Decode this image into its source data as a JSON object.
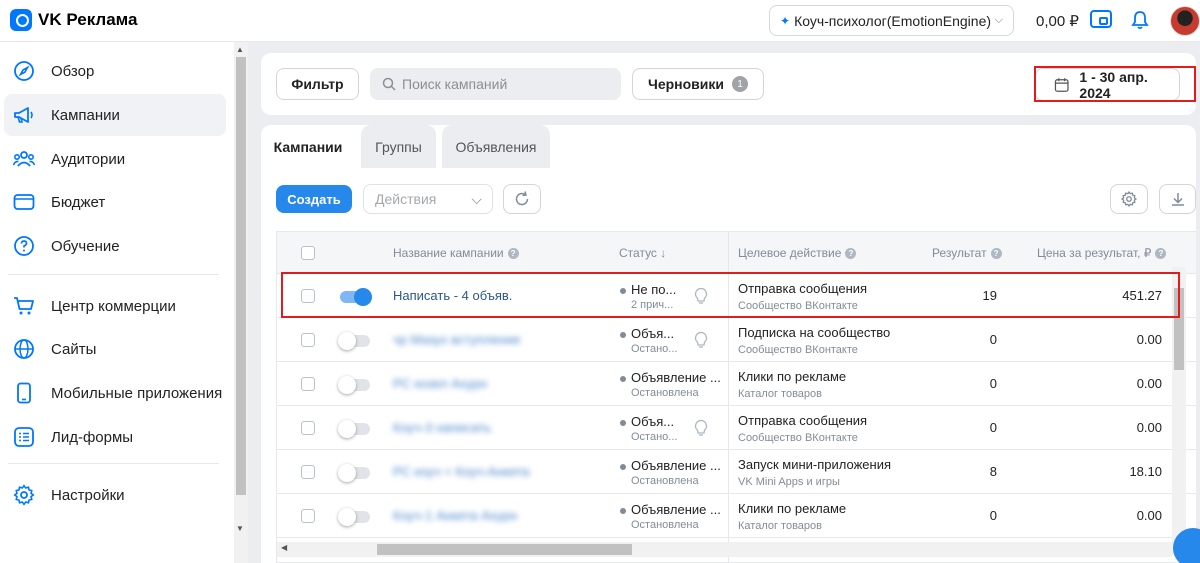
{
  "app": {
    "title": "VK Реклама"
  },
  "header": {
    "account": "Коуч-психолог(EmotionEngine)",
    "balance": "0,00 ₽"
  },
  "sidebar": {
    "items": [
      {
        "label": "Обзор",
        "icon": "compass-icon",
        "active": false
      },
      {
        "label": "Кампании",
        "icon": "megaphone-icon",
        "active": true
      },
      {
        "label": "Аудитории",
        "icon": "users-icon",
        "active": false
      },
      {
        "label": "Бюджет",
        "icon": "wallet-icon",
        "active": false
      },
      {
        "label": "Обучение",
        "icon": "question-icon",
        "active": false
      },
      {
        "label": "Центр коммерции",
        "icon": "cart-icon",
        "active": false
      },
      {
        "label": "Сайты",
        "icon": "globe-icon",
        "active": false
      },
      {
        "label": "Мобильные приложения",
        "icon": "phone-icon",
        "active": false
      },
      {
        "label": "Лид-формы",
        "icon": "list-icon",
        "active": false
      },
      {
        "label": "Настройки",
        "icon": "gear-icon",
        "active": false
      }
    ]
  },
  "filters": {
    "filter_label": "Фильтр",
    "search_placeholder": "Поиск кампаний",
    "drafts_label": "Черновики",
    "drafts_count": "1",
    "date_range": "1 - 30 апр. 2024"
  },
  "tabs": [
    {
      "label": "Кампании",
      "active": true
    },
    {
      "label": "Группы",
      "active": false
    },
    {
      "label": "Объявления",
      "active": false
    }
  ],
  "toolbar": {
    "create_label": "Создать",
    "actions_placeholder": "Действия"
  },
  "table": {
    "columns": {
      "name": "Название кампании",
      "status": "Статус",
      "status_sort": "↓",
      "target": "Целевое действие",
      "result": "Результат",
      "price": "Цена за результат, ₽"
    },
    "rows": [
      {
        "enabled": true,
        "name": "Написать - 4 объяв.",
        "name_blurred": false,
        "status": "Не по...",
        "status_sub": "2 прич...",
        "has_tip": true,
        "target": "Отправка сообщения",
        "target_sub": "Сообщество ВКонтакте",
        "result": "19",
        "price": "451.27"
      },
      {
        "enabled": false,
        "name": "чр Мазух вступление",
        "name_blurred": true,
        "status": "Объя...",
        "status_sub": "Остано...",
        "has_tip": true,
        "target": "Подписка на сообщество",
        "target_sub": "Сообщество ВКонтакте",
        "result": "0",
        "price": "0.00"
      },
      {
        "enabled": false,
        "name": "РС козел Ахурн",
        "name_blurred": true,
        "status": "Объявление ...",
        "status_sub": "Остановлена",
        "has_tip": false,
        "target": "Клики по рекламе",
        "target_sub": "Каталог товаров",
        "result": "0",
        "price": "0.00"
      },
      {
        "enabled": false,
        "name": "Коуч-3 написать",
        "name_blurred": true,
        "status": "Объя...",
        "status_sub": "Остано...",
        "has_tip": true,
        "target": "Отправка сообщения",
        "target_sub": "Сообщество ВКонтакте",
        "result": "0",
        "price": "0.00"
      },
      {
        "enabled": false,
        "name": "РС коуч + Коуч-Анкета",
        "name_blurred": true,
        "status": "Объявление ...",
        "status_sub": "Остановлена",
        "has_tip": false,
        "target": "Запуск мини-приложения",
        "target_sub": "VK Mini Apps и игры",
        "result": "8",
        "price": "18.10"
      },
      {
        "enabled": false,
        "name": "Коуч-1 Анкета Ахурн",
        "name_blurred": true,
        "status": "Объявление ...",
        "status_sub": "Остановлена",
        "has_tip": false,
        "target": "Клики по рекламе",
        "target_sub": "Каталог товаров",
        "result": "0",
        "price": "0.00"
      }
    ]
  },
  "colors": {
    "accent": "#2688eb",
    "highlight": "#e01c1c"
  }
}
